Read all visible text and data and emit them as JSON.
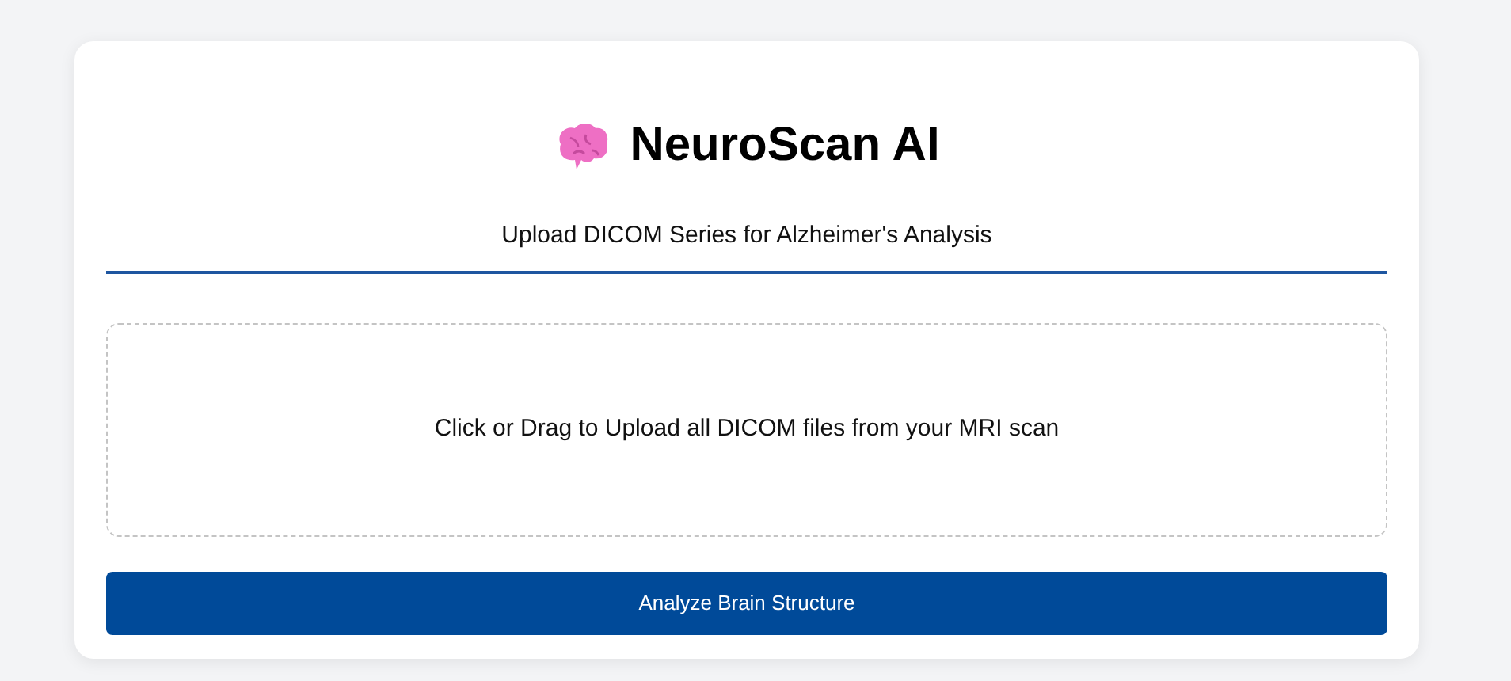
{
  "header": {
    "title": "NeuroScan AI",
    "subtitle": "Upload DICOM Series for Alzheimer's Analysis"
  },
  "dropzone": {
    "label": "Click or Drag to Upload all DICOM files from your MRI scan"
  },
  "button": {
    "label": "Analyze Brain Structure"
  }
}
